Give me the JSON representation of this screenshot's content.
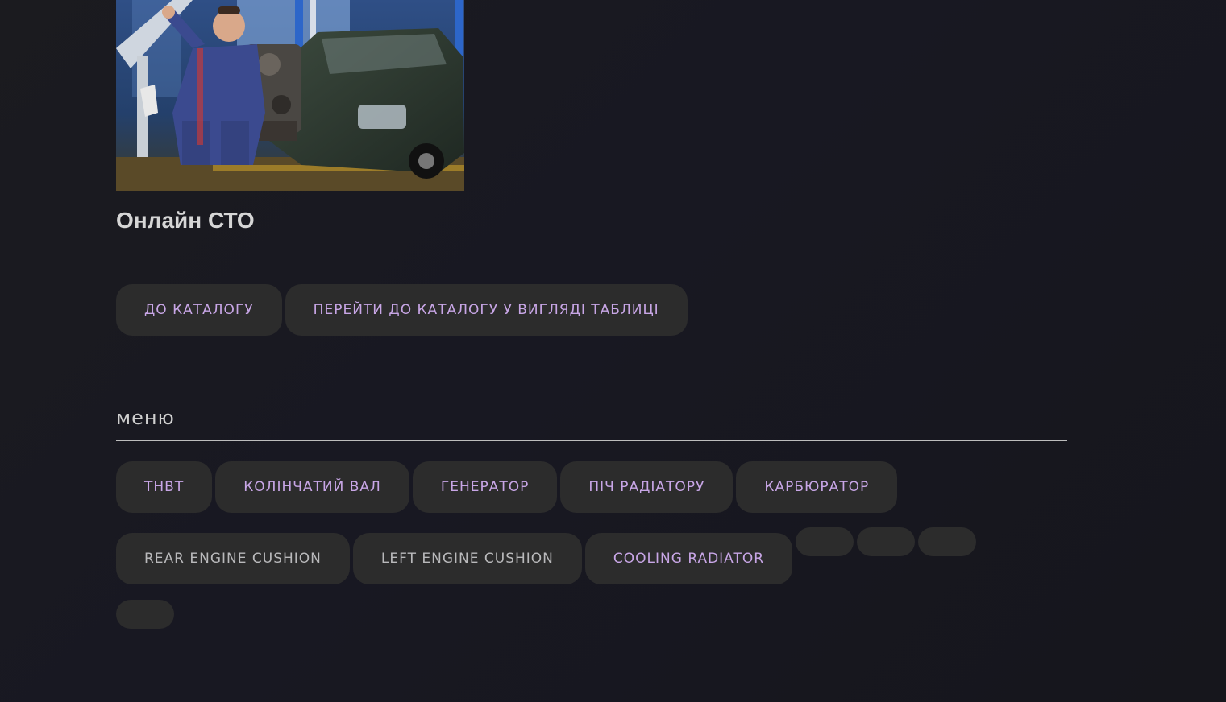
{
  "hero": {
    "image_alt": "Mechanic holding an engine next to a dark green SUV in a workshop"
  },
  "page_title": "Онлайн СТО",
  "catalog_buttons": [
    {
      "label": "ДО КАТАЛОГУ"
    },
    {
      "label": "ПЕРЕЙТИ ДО КАТАЛОГУ У ВИГЛЯДІ ТАБЛИЦІ"
    }
  ],
  "menu": {
    "heading": "меню",
    "items_row1": [
      {
        "label": "ТНВТ"
      },
      {
        "label": "КОЛІНЧАТИЙ ВАЛ"
      },
      {
        "label": "ГЕНЕРАТОР"
      },
      {
        "label": "ПІЧ РАДІАТОРУ"
      },
      {
        "label": "КАРБЮРАТОР"
      }
    ],
    "items_row2": [
      {
        "label": "REAR ENGINE CUSHION"
      },
      {
        "label": "LEFT ENGINE CUSHION"
      },
      {
        "label": "COOLING RADIATOR"
      }
    ]
  },
  "colors": {
    "background": "#18181e",
    "button_bg": "#2c2c2c",
    "accent_text": "#c8a6e6",
    "muted_text": "#b9b9bb",
    "title_text": "#d6d6d6"
  }
}
